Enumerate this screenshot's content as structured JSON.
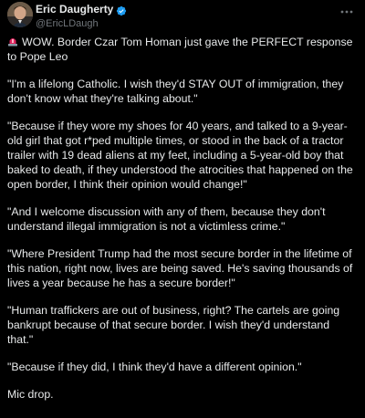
{
  "author": {
    "display_name": "Eric Daugherty",
    "handle": "@EricLDaugh",
    "verified": true,
    "verified_icon": "verified-badge-icon",
    "avatar_icon": "profile-photo"
  },
  "actions": {
    "more_icon": "more-options-icon"
  },
  "post": {
    "lead_icon": "police-siren-emoji",
    "paragraphs": [
      "WOW. Border Czar Tom Homan just gave the PERFECT response to Pope Leo",
      "\"I'm a lifelong Catholic. I wish they'd STAY OUT of immigration, they don't know what they're talking about.\"",
      "\"Because if they wore my shoes for 40 years, and talked to a 9-year-old girl that got r*ped multiple times, or stood in the back of a tractor trailer with 19 dead aliens at my feet, including a 5-year-old boy that baked to death, if they understood the atrocities that happened on the open border, I think their opinion would change!\"",
      "\"And I welcome discussion with any of them, because they don't understand illegal immigration is not a victimless crime.\"",
      "\"Where President Trump had the most secure border in the lifetime of this nation, right now, lives are being saved. He's saving thousands of lives a year because he has a secure border!\"",
      "\"Human traffickers are out of business, right? The cartels are going bankrupt because of that secure border. I wish they'd understand that.\"",
      "\"Because if they did, I think they'd have a different opinion.\"",
      "Mic drop."
    ]
  },
  "colors": {
    "background": "#000000",
    "text": "#e7e9ea",
    "secondary_text": "#71767b",
    "verified_blue": "#1d9bf0",
    "siren_red": "#e0245e"
  }
}
